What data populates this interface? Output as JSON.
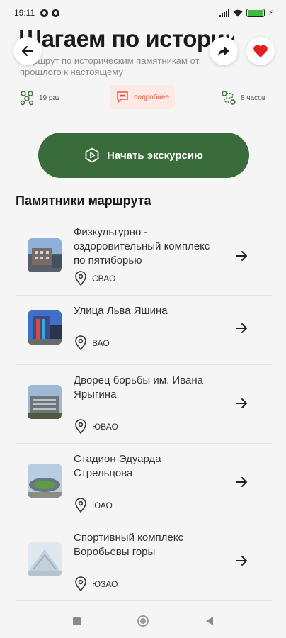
{
  "status_bar": {
    "time": "19:11"
  },
  "header": {
    "title": "Шагаем по истории",
    "subtitle": "Маршрут по историческим памятникам от прошлого к настоящему"
  },
  "stats": {
    "visits": "19 раз",
    "more": "подробнее",
    "duration": "8 часов"
  },
  "start_button": {
    "label": "Начать экскурсию"
  },
  "section": {
    "title": "Памятники маршрута"
  },
  "monuments": [
    {
      "name": "Физкультурно - оздоровительный комплекс по пятиборью",
      "district": "СВАО"
    },
    {
      "name": "Улица Льва Яшина",
      "district": "ВАО"
    },
    {
      "name": "Дворец борьбы им. Ивана Ярыгина",
      "district": "ЮВАО"
    },
    {
      "name": "Стадион Эдуарда Стрельцова",
      "district": "ЮАО"
    },
    {
      "name": "Спортивный комплекс Воробьевы горы",
      "district": "ЮЗАО"
    }
  ],
  "colors": {
    "accent": "#3a6b3a",
    "favorite": "#e02020",
    "more_badge": "#e0553f"
  },
  "icons": {
    "back": "arrow-left-icon",
    "share": "share-icon",
    "favorite": "heart-icon",
    "visits": "people-icon",
    "more": "chat-icon",
    "duration": "route-icon",
    "start": "play-hexagon-icon",
    "location": "location-pin-icon",
    "chevron": "arrow-right-icon"
  }
}
